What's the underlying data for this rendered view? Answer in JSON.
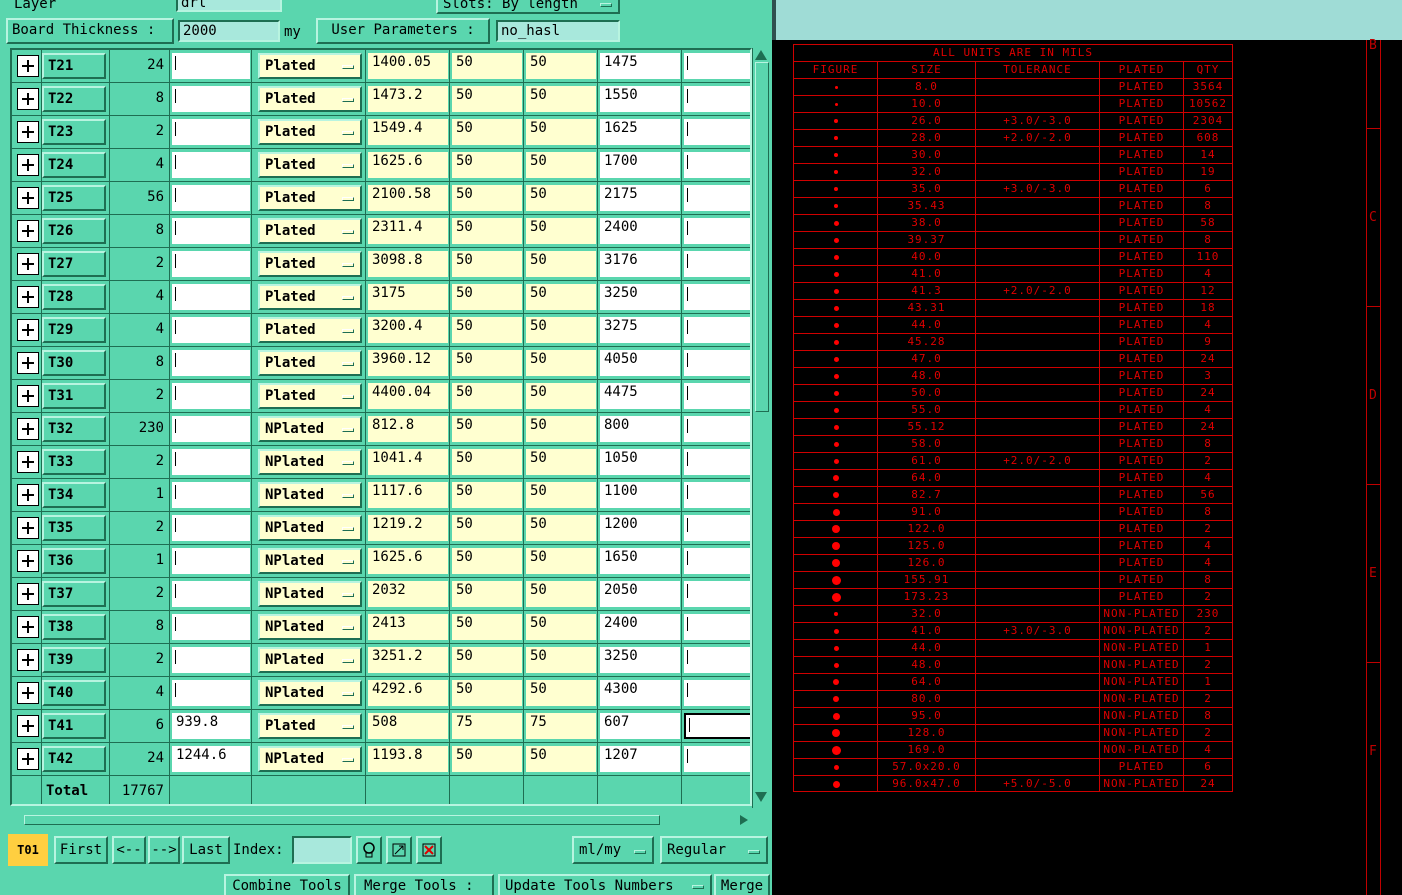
{
  "header": {
    "layer_label": "Layer",
    "layer_value": "drl",
    "slots_label": "Slots:",
    "slots_value": "By length",
    "board_thickness_label": "Board Thickness :",
    "board_thickness_value": "2000",
    "board_thickness_unit": "my",
    "user_params_label": "User Parameters :",
    "user_params_value": "no_hasl"
  },
  "rows": [
    {
      "tool": "T21",
      "qty": "24",
      "c1": "",
      "finish": "Plated",
      "c2": "1400.05",
      "c3": "50",
      "c4": "50",
      "c5": "1475",
      "c6": ""
    },
    {
      "tool": "T22",
      "qty": "8",
      "c1": "",
      "finish": "Plated",
      "c2": "1473.2",
      "c3": "50",
      "c4": "50",
      "c5": "1550",
      "c6": ""
    },
    {
      "tool": "T23",
      "qty": "2",
      "c1": "",
      "finish": "Plated",
      "c2": "1549.4",
      "c3": "50",
      "c4": "50",
      "c5": "1625",
      "c6": ""
    },
    {
      "tool": "T24",
      "qty": "4",
      "c1": "",
      "finish": "Plated",
      "c2": "1625.6",
      "c3": "50",
      "c4": "50",
      "c5": "1700",
      "c6": ""
    },
    {
      "tool": "T25",
      "qty": "56",
      "c1": "",
      "finish": "Plated",
      "c2": "2100.58",
      "c3": "50",
      "c4": "50",
      "c5": "2175",
      "c6": ""
    },
    {
      "tool": "T26",
      "qty": "8",
      "c1": "",
      "finish": "Plated",
      "c2": "2311.4",
      "c3": "50",
      "c4": "50",
      "c5": "2400",
      "c6": ""
    },
    {
      "tool": "T27",
      "qty": "2",
      "c1": "",
      "finish": "Plated",
      "c2": "3098.8",
      "c3": "50",
      "c4": "50",
      "c5": "3176",
      "c6": ""
    },
    {
      "tool": "T28",
      "qty": "4",
      "c1": "",
      "finish": "Plated",
      "c2": "3175",
      "c3": "50",
      "c4": "50",
      "c5": "3250",
      "c6": ""
    },
    {
      "tool": "T29",
      "qty": "4",
      "c1": "",
      "finish": "Plated",
      "c2": "3200.4",
      "c3": "50",
      "c4": "50",
      "c5": "3275",
      "c6": ""
    },
    {
      "tool": "T30",
      "qty": "8",
      "c1": "",
      "finish": "Plated",
      "c2": "3960.12",
      "c3": "50",
      "c4": "50",
      "c5": "4050",
      "c6": ""
    },
    {
      "tool": "T31",
      "qty": "2",
      "c1": "",
      "finish": "Plated",
      "c2": "4400.04",
      "c3": "50",
      "c4": "50",
      "c5": "4475",
      "c6": ""
    },
    {
      "tool": "T32",
      "qty": "230",
      "c1": "",
      "finish": "NPlated",
      "c2": "812.8",
      "c3": "50",
      "c4": "50",
      "c5": "800",
      "c6": ""
    },
    {
      "tool": "T33",
      "qty": "2",
      "c1": "",
      "finish": "NPlated",
      "c2": "1041.4",
      "c3": "50",
      "c4": "50",
      "c5": "1050",
      "c6": ""
    },
    {
      "tool": "T34",
      "qty": "1",
      "c1": "",
      "finish": "NPlated",
      "c2": "1117.6",
      "c3": "50",
      "c4": "50",
      "c5": "1100",
      "c6": ""
    },
    {
      "tool": "T35",
      "qty": "2",
      "c1": "",
      "finish": "NPlated",
      "c2": "1219.2",
      "c3": "50",
      "c4": "50",
      "c5": "1200",
      "c6": ""
    },
    {
      "tool": "T36",
      "qty": "1",
      "c1": "",
      "finish": "NPlated",
      "c2": "1625.6",
      "c3": "50",
      "c4": "50",
      "c5": "1650",
      "c6": ""
    },
    {
      "tool": "T37",
      "qty": "2",
      "c1": "",
      "finish": "NPlated",
      "c2": "2032",
      "c3": "50",
      "c4": "50",
      "c5": "2050",
      "c6": ""
    },
    {
      "tool": "T38",
      "qty": "8",
      "c1": "",
      "finish": "NPlated",
      "c2": "2413",
      "c3": "50",
      "c4": "50",
      "c5": "2400",
      "c6": ""
    },
    {
      "tool": "T39",
      "qty": "2",
      "c1": "",
      "finish": "NPlated",
      "c2": "3251.2",
      "c3": "50",
      "c4": "50",
      "c5": "3250",
      "c6": ""
    },
    {
      "tool": "T40",
      "qty": "4",
      "c1": "",
      "finish": "NPlated",
      "c2": "4292.6",
      "c3": "50",
      "c4": "50",
      "c5": "4300",
      "c6": ""
    },
    {
      "tool": "T41",
      "qty": "6",
      "c1": "939.8",
      "finish": "Plated",
      "c2": "508",
      "c3": "75",
      "c4": "75",
      "c5": "607",
      "c6": ""
    },
    {
      "tool": "T42",
      "qty": "24",
      "c1": "1244.6",
      "finish": "NPlated",
      "c2": "1193.8",
      "c3": "50",
      "c4": "50",
      "c5": "1207",
      "c6": ""
    }
  ],
  "total": {
    "label": "Total",
    "value": "17767"
  },
  "nav": {
    "current_tool": "T01",
    "first": "First",
    "prev": "<--",
    "next": "-->",
    "last": "Last",
    "index_label": "Index:",
    "index_value": "",
    "units": "ml/my",
    "mode": "Regular"
  },
  "bottom": {
    "combine": "Combine Tools",
    "merge_label": "Merge Tools :",
    "update": "Update Tools Numbers",
    "merge_btn": "Merge"
  },
  "drill": {
    "header": "ALL UNITS ARE IN MILS",
    "columns": [
      "FIGURE",
      "SIZE",
      "TOLERANCE",
      "PLATED",
      "QTY"
    ],
    "rows": [
      {
        "size": "8.0",
        "tol": "",
        "plated": "PLATED",
        "qty": "3564"
      },
      {
        "size": "10.0",
        "tol": "",
        "plated": "PLATED",
        "qty": "10562"
      },
      {
        "size": "26.0",
        "tol": "+3.0/-3.0",
        "plated": "PLATED",
        "qty": "2304"
      },
      {
        "size": "28.0",
        "tol": "+2.0/-2.0",
        "plated": "PLATED",
        "qty": "608"
      },
      {
        "size": "30.0",
        "tol": "",
        "plated": "PLATED",
        "qty": "14"
      },
      {
        "size": "32.0",
        "tol": "",
        "plated": "PLATED",
        "qty": "19"
      },
      {
        "size": "35.0",
        "tol": "+3.0/-3.0",
        "plated": "PLATED",
        "qty": "6"
      },
      {
        "size": "35.43",
        "tol": "",
        "plated": "PLATED",
        "qty": "8"
      },
      {
        "size": "38.0",
        "tol": "",
        "plated": "PLATED",
        "qty": "58"
      },
      {
        "size": "39.37",
        "tol": "",
        "plated": "PLATED",
        "qty": "8"
      },
      {
        "size": "40.0",
        "tol": "",
        "plated": "PLATED",
        "qty": "110"
      },
      {
        "size": "41.0",
        "tol": "",
        "plated": "PLATED",
        "qty": "4"
      },
      {
        "size": "41.3",
        "tol": "+2.0/-2.0",
        "plated": "PLATED",
        "qty": "12"
      },
      {
        "size": "43.31",
        "tol": "",
        "plated": "PLATED",
        "qty": "18"
      },
      {
        "size": "44.0",
        "tol": "",
        "plated": "PLATED",
        "qty": "4"
      },
      {
        "size": "45.28",
        "tol": "",
        "plated": "PLATED",
        "qty": "9"
      },
      {
        "size": "47.0",
        "tol": "",
        "plated": "PLATED",
        "qty": "24"
      },
      {
        "size": "48.0",
        "tol": "",
        "plated": "PLATED",
        "qty": "3"
      },
      {
        "size": "50.0",
        "tol": "",
        "plated": "PLATED",
        "qty": "24"
      },
      {
        "size": "55.0",
        "tol": "",
        "plated": "PLATED",
        "qty": "4"
      },
      {
        "size": "55.12",
        "tol": "",
        "plated": "PLATED",
        "qty": "24"
      },
      {
        "size": "58.0",
        "tol": "",
        "plated": "PLATED",
        "qty": "8"
      },
      {
        "size": "61.0",
        "tol": "+2.0/-2.0",
        "plated": "PLATED",
        "qty": "2"
      },
      {
        "size": "64.0",
        "tol": "",
        "plated": "PLATED",
        "qty": "4"
      },
      {
        "size": "82.7",
        "tol": "",
        "plated": "PLATED",
        "qty": "56"
      },
      {
        "size": "91.0",
        "tol": "",
        "plated": "PLATED",
        "qty": "8"
      },
      {
        "size": "122.0",
        "tol": "",
        "plated": "PLATED",
        "qty": "2"
      },
      {
        "size": "125.0",
        "tol": "",
        "plated": "PLATED",
        "qty": "4"
      },
      {
        "size": "126.0",
        "tol": "",
        "plated": "PLATED",
        "qty": "4"
      },
      {
        "size": "155.91",
        "tol": "",
        "plated": "PLATED",
        "qty": "8"
      },
      {
        "size": "173.23",
        "tol": "",
        "plated": "PLATED",
        "qty": "2"
      },
      {
        "size": "32.0",
        "tol": "",
        "plated": "NON-PLATED",
        "qty": "230"
      },
      {
        "size": "41.0",
        "tol": "+3.0/-3.0",
        "plated": "NON-PLATED",
        "qty": "2"
      },
      {
        "size": "44.0",
        "tol": "",
        "plated": "NON-PLATED",
        "qty": "1"
      },
      {
        "size": "48.0",
        "tol": "",
        "plated": "NON-PLATED",
        "qty": "2"
      },
      {
        "size": "64.0",
        "tol": "",
        "plated": "NON-PLATED",
        "qty": "1"
      },
      {
        "size": "80.0",
        "tol": "",
        "plated": "NON-PLATED",
        "qty": "2"
      },
      {
        "size": "95.0",
        "tol": "",
        "plated": "NON-PLATED",
        "qty": "8"
      },
      {
        "size": "128.0",
        "tol": "",
        "plated": "NON-PLATED",
        "qty": "2"
      },
      {
        "size": "169.0",
        "tol": "",
        "plated": "NON-PLATED",
        "qty": "4"
      },
      {
        "size": "57.0x20.0",
        "tol": "",
        "plated": "PLATED",
        "qty": "6"
      },
      {
        "size": "96.0x47.0",
        "tol": "+5.0/-5.0",
        "plated": "NON-PLATED",
        "qty": "24"
      }
    ],
    "zone_labels": [
      "B",
      "C",
      "D",
      "E",
      "F"
    ]
  },
  "colors": {
    "panel": "#5ad6ae",
    "field_yellow": "#ffffd0",
    "drill_red": "#e00000"
  }
}
